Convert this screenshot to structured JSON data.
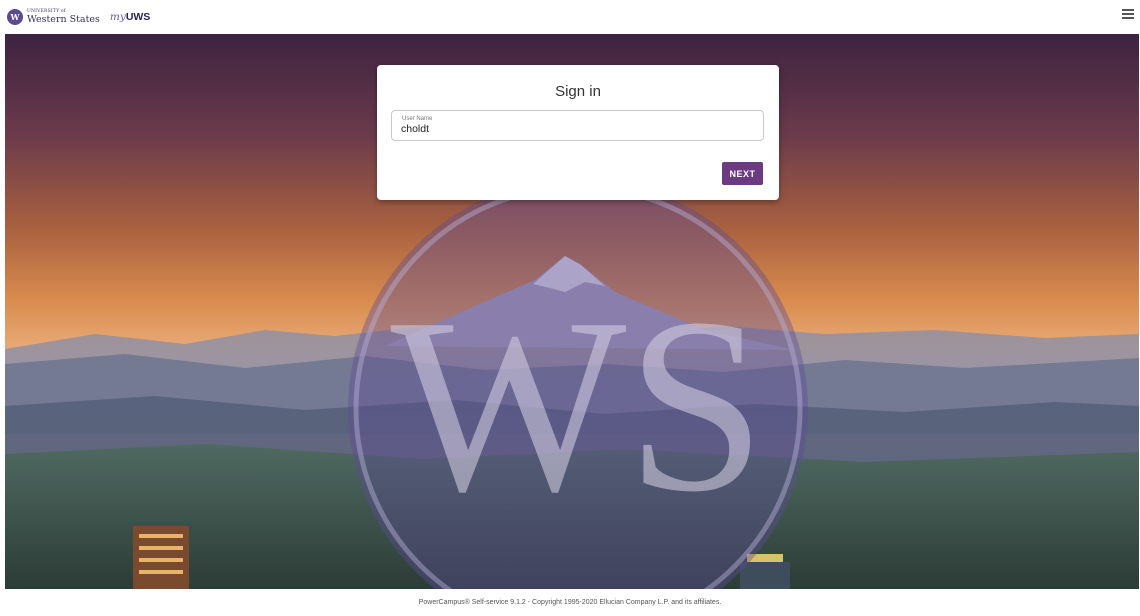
{
  "header": {
    "logo_seal": "W",
    "logo_university": "UNIVERSITY of",
    "logo_name": "Western States",
    "app_brand_prefix": "my",
    "app_brand_main": "UWS"
  },
  "hero": {
    "watermark_letters": "WS",
    "colors": {
      "sky_top": "#4c2b49",
      "sky_mid": "#c37c45",
      "horizon": "#e4a46f",
      "emblem": "#5e4d93"
    }
  },
  "signin": {
    "title": "Sign in",
    "username_label": "User Name",
    "username_value": "choldt",
    "next_label": "NEXT",
    "accent_color": "#6c3a80"
  },
  "footer": {
    "copyright": "PowerCampus® Self-service 9.1.2 - Copyright 1995-2020 Ellucian Company L.P. and its affiliates."
  }
}
